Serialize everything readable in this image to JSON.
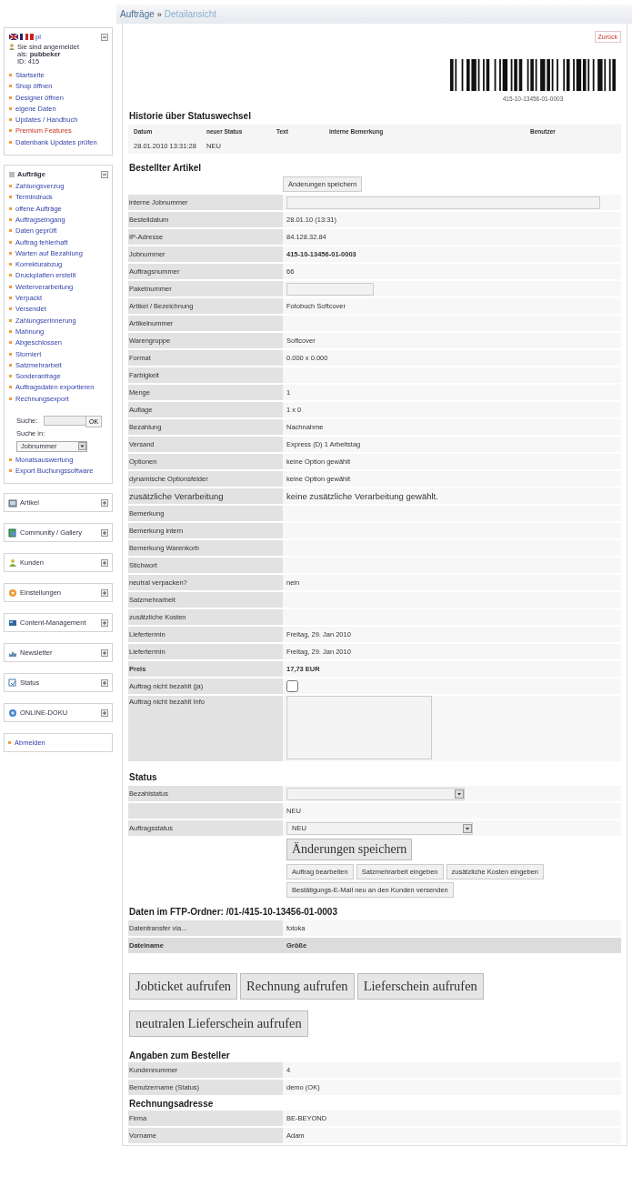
{
  "breadcrumb": {
    "separator": "»",
    "items": [
      {
        "label": "Aufträge",
        "current": false
      },
      {
        "label": "Detailansicht",
        "current": true
      }
    ]
  },
  "sidebar": {
    "account": {
      "expanded": true,
      "language_code": "pl",
      "login_text": "Sie sind angemeldet als: **pubbeker**",
      "user_id": "ID: 415",
      "links": [
        {
          "label": "Startseite",
          "kind": "normal"
        },
        {
          "label": "Shop öffnen",
          "kind": "normal"
        },
        {
          "label": "Designer öffnen",
          "kind": "normal"
        },
        {
          "label": "eigene Daten",
          "kind": "normal"
        },
        {
          "label": "Updates / Handbuch",
          "kind": "normal"
        },
        {
          "label": "Premium Features",
          "kind": "premium"
        },
        {
          "label": "Datenbank Updates prüfen",
          "kind": "normal"
        }
      ]
    },
    "orders": {
      "title": "Aufträge",
      "expanded": true,
      "links": [
        "Zahlungsverzug",
        "Termindruck",
        "offene Aufträge",
        "Auftragseingang",
        "Daten geprüft",
        "Auftrag fehlerhaft",
        "Warten auf Bezahlung",
        "Korrekturabzug",
        "Druckplatten erstellt",
        "Weiterverarbeitung",
        "Verpackt",
        "Versendet",
        "Zahlungserinnerung",
        "Mahnung",
        "Abgeschlossen",
        "Storniert",
        "Satzmehrarbeit",
        "Sonderanfrage",
        "Auftragsdaten exportieren",
        "Rechnungsexport"
      ],
      "search": {
        "label": "Suche:",
        "button": "OK",
        "scope_label": "Suche in:",
        "scope_value": "Jobnummer"
      },
      "more_links": [
        "Monatsauswertung",
        "Export Buchungssoftware"
      ]
    },
    "sections": [
      {
        "title": "Artikel",
        "expanded": false
      },
      {
        "title": "Community / Gallery",
        "expanded": false
      },
      {
        "title": "Kunden",
        "expanded": false
      },
      {
        "title": "Einstellungen",
        "expanded": false
      },
      {
        "title": "Content-Management",
        "expanded": false
      },
      {
        "title": "Newsletter",
        "expanded": false
      },
      {
        "title": "Status",
        "expanded": false
      },
      {
        "title": "ONLINE-DOKU",
        "expanded": false
      }
    ],
    "logout": "Abmelden"
  },
  "main": {
    "back_button": "Zurück",
    "barcode_text": "415-10-13456-01-0003",
    "history": {
      "title": "Historie über Statuswechsel",
      "columns": [
        "Datum",
        "neuer Status",
        "Text",
        "interne Bemerkung",
        "Benutzer"
      ],
      "rows": [
        {
          "cells": [
            "28.01.2010 13:31:28",
            "NEU"
          ]
        }
      ]
    },
    "article": {
      "title": "Bestellter Artikel",
      "save_button": "Änderungen speichern",
      "fields": [
        {
          "label": "interne Jobnummer",
          "kind": "input"
        },
        {
          "label": "Bestelldatum",
          "kind": "text",
          "value": "28.01.10 (13:31)"
        },
        {
          "label": "IP-Adresse",
          "kind": "text",
          "value": "84.128.32.84"
        },
        {
          "label": "Jobnummer",
          "kind": "strong",
          "value": "415-10-13456-01-0003"
        },
        {
          "label": "Auftragsnummer",
          "kind": "text",
          "value": "66"
        },
        {
          "label": "Paketnummer",
          "kind": "short_input"
        },
        {
          "label": "Artikel / Bezeichnung",
          "kind": "text",
          "value": "Fotobuch Softcover"
        },
        {
          "label": "Artikelnummer",
          "kind": "text"
        },
        {
          "label": "Warengruppe",
          "kind": "text",
          "value": "Softcover"
        },
        {
          "label": "Format",
          "kind": "text",
          "value": "0.000 x 0.000"
        },
        {
          "label": "Farbigkeit",
          "kind": "text"
        },
        {
          "label": "Menge",
          "kind": "text",
          "value": "1"
        },
        {
          "label": "Auflage",
          "kind": "text",
          "value": "1 x 0"
        },
        {
          "label": "Bezahlung",
          "kind": "text",
          "value": "Nachnahme"
        },
        {
          "label": "Versand",
          "kind": "text",
          "value": "Express (D) 1 Arbeitstag"
        },
        {
          "label": "Optionen",
          "kind": "text",
          "value": "keine Option gewählt"
        },
        {
          "label": "dynamische Optionsfelder",
          "kind": "text",
          "value": "keine Option gewählt"
        },
        {
          "label": "zusätzliche Verarbeitung",
          "kind": "large",
          "value": "keine zusätzliche Verarbeitung gewählt."
        },
        {
          "label": "Bemerkung",
          "kind": "text"
        },
        {
          "label": "Bemerkung intern",
          "kind": "text"
        },
        {
          "label": "Bemerkung Warenkorb",
          "kind": "text"
        },
        {
          "label": "Stichwort",
          "kind": "text"
        },
        {
          "label": "neutral verpacken?",
          "kind": "text",
          "value": "nein"
        },
        {
          "label": "Satzmehrarbeit",
          "kind": "text"
        },
        {
          "label": "zusätzliche Kosten",
          "kind": "text"
        },
        {
          "label": "Liefertermin",
          "kind": "text",
          "value": "Freitag, 29. Jan 2010"
        },
        {
          "label": "Liefertermin",
          "kind": "text",
          "value": "Freitag, 29. Jan 2010"
        },
        {
          "label": "Preis",
          "kind": "total",
          "value": "17,73 EUR"
        },
        {
          "label": "Auftrag nicht bezahlt (ja)",
          "kind": "checkbox",
          "checked": false
        },
        {
          "label": "Auftrag nicht bezahlt Info",
          "kind": "textarea"
        }
      ]
    },
    "status": {
      "title": "Status",
      "fields": [
        {
          "label": "Bezahlstatus",
          "kind": "select"
        },
        {
          "kind": "text",
          "value": "NEU"
        },
        {
          "label": "Auftragsstatus",
          "kind": "select",
          "value": "NEU"
        }
      ],
      "save_button": "Änderungen speichern",
      "actions": [
        "Auftrag bearbeiten",
        "Satzmehrarbeit eingeben",
        "zusätzliche Kosten eingeben",
        "Bestätigungs-E-Mail neu an den Kunden versenden"
      ]
    },
    "ftp": {
      "title": "Daten im FTP-Ordner: /01-/415-10-13456-01-0003",
      "rows": [
        {
          "label": "Datentransfer via...",
          "value": "fotoka",
          "kind": "text"
        },
        {
          "label": "Dateiname",
          "value": "Größe",
          "kind": "header"
        }
      ]
    },
    "document_buttons": [
      "Jobticket aufrufen",
      "Rechnung aufrufen",
      "Lieferschein aufrufen",
      "neutralen Lieferschein aufrufen"
    ],
    "customer": {
      "title": "Angaben zum Besteller",
      "rows": [
        {
          "label": "Kundennummer",
          "value": "4"
        },
        {
          "label": "Benutzername (Status)",
          "value": "demo (OK)"
        }
      ]
    },
    "billing": {
      "title": "Rechnungsadresse",
      "rows": [
        {
          "label": "Firma",
          "value": "BE-BEYOND"
        },
        {
          "label": "Vorname",
          "value": "Adam"
        }
      ]
    }
  }
}
